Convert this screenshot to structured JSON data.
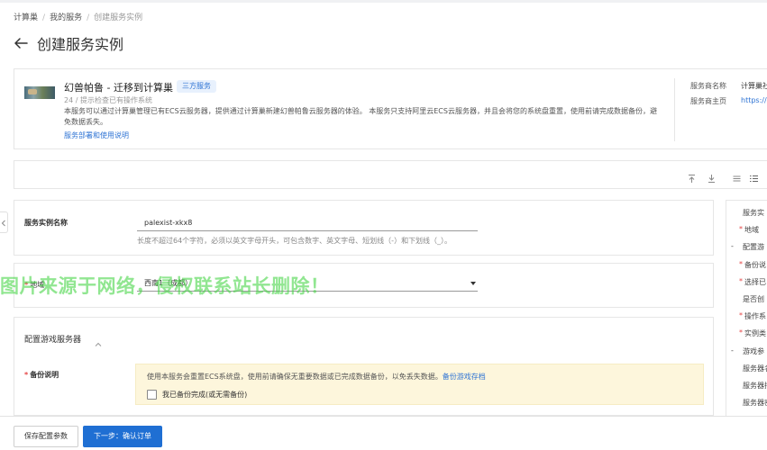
{
  "breadcrumb": {
    "items": [
      "计算巢",
      "我的服务",
      "创建服务实例"
    ]
  },
  "page": {
    "title": "创建服务实例"
  },
  "service": {
    "name": "幻兽帕鲁 - 迁移到计算巢",
    "tag": "三方服务",
    "meta": "24 / 提示检查已有操作系统",
    "description": "本服务可以通过计算巢管理已有ECS云服务器，提供通过计算巢新建幻兽帕鲁云服务器的体验。 本服务只支持阿里云ECS云服务器，并且会将您的系统盘重置，使用前请完成数据备份，避免数据丢失。",
    "guide_link": "服务部署和使用说明",
    "provider_name_label": "服务商名称",
    "provider_name_value": "计算巢社",
    "provider_home_label": "服务商主页",
    "provider_home_value": "https://c"
  },
  "form": {
    "instance_name": {
      "label": "服务实例名称",
      "value": "palexist-xkx8",
      "hint": "长度不超过64个字符，必须以英文字母开头，可包含数字、英文字母、短划线（-）和下划线（_）。"
    },
    "region": {
      "label": "地域",
      "value": "西南1（成都）"
    },
    "game_server": {
      "section_title": "配置游戏服务器",
      "backup_label": "备份说明",
      "backup_notice": "使用本服务会重置ECS系统盘，使用前请确保无重要数据或已完成数据备份，以免丢失数据。",
      "backup_link": "备份游戏存档",
      "backup_checkbox": "我已备份完成(或无需备份)"
    }
  },
  "right_nav": {
    "items": [
      {
        "label": "服务实",
        "bullet": ""
      },
      {
        "label": "地域",
        "bullet": "*"
      },
      {
        "label": "配置游",
        "bullet": "-"
      },
      {
        "label": "备份说",
        "bullet": "*"
      },
      {
        "label": "选择已",
        "bullet": "*"
      },
      {
        "label": "是否创",
        "bullet": ""
      },
      {
        "label": "操作系",
        "bullet": "*"
      },
      {
        "label": "实例类",
        "bullet": "*"
      },
      {
        "label": "游戏参",
        "bullet": "-"
      },
      {
        "label": "服务器名",
        "bullet": ""
      },
      {
        "label": "服务器描",
        "bullet": ""
      },
      {
        "label": "服务器密",
        "bullet": ""
      }
    ]
  },
  "watermark": "图片来源于网络，侵权联系站长删除！",
  "footer": {
    "save_button": "保存配置参数",
    "next_button": "下一步：确认订单"
  },
  "colors": {
    "accent": "#1f6fd3",
    "link": "#2f74d4",
    "required": "#e54545",
    "warning_bg": "#fdf6dc",
    "watermark": "#47d547"
  }
}
